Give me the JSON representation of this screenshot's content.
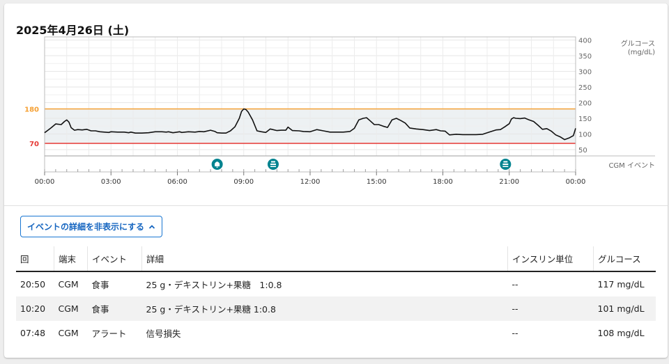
{
  "header": {
    "title": "2025年4月26日 (土)"
  },
  "chart_data": {
    "type": "line",
    "xlabel": "",
    "ylabel": "グルコース\n(mg/dL)",
    "x_ticks": [
      "00:00",
      "03:00",
      "06:00",
      "09:00",
      "12:00",
      "15:00",
      "18:00",
      "21:00",
      "00:00"
    ],
    "y_ticks": [
      50,
      100,
      150,
      200,
      250,
      300,
      350,
      400
    ],
    "ylim": [
      30,
      410
    ],
    "xlim_hours": [
      0,
      24
    ],
    "thresholds": [
      {
        "label": "180",
        "value": 180,
        "color": "#f5a033"
      },
      {
        "label": "70",
        "value": 70,
        "color": "#e53935"
      }
    ],
    "event_lane_label": "CGM イベント",
    "events": [
      {
        "time_h": 7.8,
        "icon": "bell-icon"
      },
      {
        "time_h": 10.33,
        "icon": "meal-icon"
      },
      {
        "time_h": 20.83,
        "icon": "meal-icon"
      }
    ],
    "series": [
      {
        "color": "#111111",
        "x": [
          0,
          0.15,
          0.3,
          0.5,
          0.75,
          0.9,
          1.0,
          1.1,
          1.2,
          1.35,
          1.5,
          1.7,
          1.9,
          2.1,
          2.3,
          2.5,
          2.7,
          2.9,
          3.0,
          3.3,
          3.6,
          3.8,
          3.9,
          4.1,
          4.4,
          4.7,
          5.0,
          5.3,
          5.5,
          5.6,
          5.8,
          6.0,
          6.1,
          6.2,
          6.5,
          6.8,
          7.0,
          7.2,
          7.5,
          7.7,
          7.8,
          8.0,
          8.2,
          8.4,
          8.6,
          8.8,
          8.9,
          9.0,
          9.1,
          9.2,
          9.4,
          9.6,
          9.8,
          10.0,
          10.2,
          10.5,
          10.7,
          10.9,
          11.0,
          11.2,
          11.5,
          11.7,
          12.0,
          12.3,
          12.6,
          12.9,
          13.2,
          13.5,
          13.8,
          14.0,
          14.2,
          14.4,
          14.55,
          14.7,
          14.9,
          15.1,
          15.3,
          15.5,
          15.7,
          15.9,
          16.1,
          16.3,
          16.5,
          16.8,
          17.1,
          17.4,
          17.7,
          17.9,
          18.1,
          18.3,
          18.6,
          18.9,
          19.2,
          19.5,
          19.8,
          20.1,
          20.4,
          20.6,
          20.8,
          21.0,
          21.1,
          21.2,
          21.3,
          21.5,
          21.7,
          21.9,
          22.1,
          22.3,
          22.5,
          22.7,
          22.9,
          23.1,
          23.3,
          23.5,
          23.7,
          23.9,
          24.0
        ],
        "y": [
          104,
          112,
          120,
          132,
          130,
          140,
          145,
          138,
          120,
          112,
          114,
          113,
          115,
          110,
          110,
          107,
          106,
          105,
          107,
          106,
          106,
          104,
          106,
          103,
          103,
          104,
          107,
          107,
          106,
          107,
          104,
          106,
          107,
          105,
          107,
          106,
          108,
          107,
          112,
          108,
          104,
          103,
          103,
          110,
          123,
          150,
          172,
          180,
          178,
          170,
          145,
          110,
          107,
          105,
          116,
          111,
          112,
          112,
          122,
          111,
          110,
          108,
          107,
          114,
          110,
          106,
          106,
          106,
          108,
          118,
          145,
          150,
          152,
          143,
          130,
          130,
          125,
          121,
          145,
          150,
          143,
          135,
          119,
          116,
          114,
          111,
          114,
          110,
          109,
          97,
          99,
          98,
          98,
          98,
          99,
          106,
          113,
          114,
          123,
          133,
          148,
          152,
          150,
          149,
          151,
          145,
          140,
          128,
          115,
          117,
          109,
          97,
          91,
          82,
          87,
          95,
          118
        ]
      }
    ]
  },
  "events_toggle": {
    "label": "イベントの詳細を非表示にする",
    "icon": "chevron-up-icon"
  },
  "events_table": {
    "columns": [
      "回",
      "端末",
      "イベント",
      "詳細",
      "インスリン単位",
      "グルコース"
    ],
    "rows": [
      [
        "20:50",
        "CGM",
        "食事",
        "25 g・デキストリン+果糖　1:0.8",
        "--",
        "117 mg/dL"
      ],
      [
        "10:20",
        "CGM",
        "食事",
        "25 g・デキストリン+果糖 1:0.8",
        "--",
        "101 mg/dL"
      ],
      [
        "07:48",
        "CGM",
        "アラート",
        "信号損失",
        "--",
        "108 mg/dL"
      ]
    ]
  },
  "colors": {
    "accent": "#1976d2",
    "high_threshold": "#f5a033",
    "low_threshold": "#e53935",
    "event_icon": "#00838f",
    "target_band": "#edf1f3"
  }
}
